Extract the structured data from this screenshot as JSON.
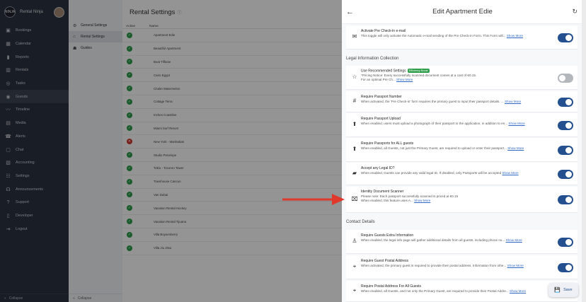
{
  "brand": {
    "name": "Rental Ninja",
    "logo_text": "NINJA"
  },
  "leftnav": {
    "items": [
      {
        "label": "Bookings",
        "icon": "book-icon",
        "glyph": "▣"
      },
      {
        "label": "Calendar",
        "icon": "calendar-icon",
        "glyph": "▦"
      },
      {
        "label": "Reports",
        "icon": "bar-chart-icon",
        "glyph": "▮"
      },
      {
        "label": "Rentals",
        "icon": "rentals-icon",
        "glyph": "▥"
      },
      {
        "label": "Tasks",
        "icon": "check-circle-icon",
        "glyph": "◎"
      },
      {
        "label": "Guests",
        "icon": "guests-icon",
        "glyph": "◉"
      },
      {
        "label": "Timeline",
        "icon": "timeline-icon",
        "glyph": "〰"
      },
      {
        "label": "Media",
        "icon": "media-icon",
        "glyph": "▤"
      },
      {
        "label": "Alerts",
        "icon": "alert-icon",
        "glyph": "☎"
      },
      {
        "label": "Chat",
        "icon": "chat-icon",
        "glyph": "▢"
      },
      {
        "label": "Accounting",
        "icon": "accounting-icon",
        "glyph": "▧"
      },
      {
        "label": "Settings",
        "icon": "settings-icon",
        "glyph": "☷"
      },
      {
        "label": "Announcements",
        "icon": "announcements-icon",
        "glyph": "☊"
      },
      {
        "label": "Support",
        "icon": "support-icon",
        "glyph": "?"
      },
      {
        "label": "Developer",
        "icon": "developer-icon",
        "glyph": "▯"
      },
      {
        "label": "Logout",
        "icon": "logout-icon",
        "glyph": "⇥"
      }
    ],
    "collapse_label": "Collapse"
  },
  "sidenav2": {
    "items": [
      {
        "label": "General Settings",
        "icon": "gear-icon",
        "glyph": "⚙"
      },
      {
        "label": "Rental Settings",
        "icon": "home-icon",
        "glyph": "⌂"
      },
      {
        "label": "Guides",
        "icon": "guides-icon",
        "glyph": "☗"
      }
    ],
    "collapse_label": "Collapse"
  },
  "main": {
    "title": "Rental Settings",
    "columns": {
      "active": "Active",
      "name": "Name"
    },
    "rows": [
      {
        "name": "Apartment Edie",
        "status": "active"
      },
      {
        "name": "Beautiful Apartment",
        "status": "active"
      },
      {
        "name": "Boat Tiffanie",
        "status": "active"
      },
      {
        "name": "Cairo Egypt",
        "status": "active"
      },
      {
        "name": "Chalet Watermelon",
        "status": "active"
      },
      {
        "name": "Cottage Terra",
        "status": "active"
      },
      {
        "name": "Inches Coastline",
        "status": "active"
      },
      {
        "name": "Miami Surf Resort",
        "status": "active"
      },
      {
        "name": "New York - Manhattan",
        "status": "inactive"
      },
      {
        "name": "Studio Penelope",
        "status": "active"
      },
      {
        "name": "Tokio - Toconru Tower",
        "status": "active"
      },
      {
        "name": "Townhouse Cancun",
        "status": "active"
      },
      {
        "name": "Van Dubai",
        "status": "active"
      },
      {
        "name": "Vacation Rental Hockey",
        "status": "active"
      },
      {
        "name": "Vacation Rental Tijuana",
        "status": "active"
      },
      {
        "name": "Villa Boysenberry",
        "status": "active"
      },
      {
        "name": "Villa Jiu Jitsu",
        "status": "active"
      }
    ]
  },
  "panel": {
    "title": "Edit Apartment Edie",
    "show_more": "Show More",
    "sections": {
      "legal": "Legal Information Collection",
      "contact": "Contact Details"
    },
    "settings": [
      {
        "title": "Activate Pre Check-in e-mail",
        "desc": "This toggle will only activate the Automatic e-mail sending of the Pre Check-in Form. This Form will...",
        "on": true,
        "icon": "email-icon",
        "glyph": "✉"
      },
      {
        "title": "Use Recommended Settings",
        "badge": "Efficiency Boost",
        "desc": "*Pricing Notice: Every successfully scanned document comes at a cost of €0.15.",
        "desc2": "For an optimal Pre Ch...",
        "on": false,
        "icon": "star-icon",
        "glyph": "☆"
      },
      {
        "title": "Require Passport Number",
        "desc": "When activated, the 'Pre Check-in' form requires the primary guest to input their passport details. ...",
        "on": true,
        "icon": "hash-icon",
        "glyph": "#"
      },
      {
        "title": "Require Passport Upload",
        "desc": "When enabled, users must upload a photograph of their passport to the application, in addition to en...",
        "on": true,
        "icon": "upload-icon",
        "glyph": "⬆"
      },
      {
        "title": "Require Passports for ALL guests",
        "desc": "When enabled, all Guests, not just the Primary Guest, are required to upload or enter their passport...",
        "on": true,
        "icon": "upload-icon",
        "glyph": "⬆"
      },
      {
        "title": "Accept any Legal ID?",
        "desc": "When enabled, Guests can provide any valid legal ID. If disabled, only Passports will be accepted",
        "on": true,
        "icon": "id-card-icon",
        "glyph": "▰"
      },
      {
        "title": "Identity Document Scanner",
        "desc": "Please note: Each passport successfully scanned is priced at €0.15",
        "desc2": "When enabled, this feature uses A...",
        "on": true,
        "icon": "scanner-icon",
        "glyph": "⌧"
      },
      {
        "title": "Require Guests Extra Information",
        "desc": "When enabled, the legal info page will gather additional details from all guests, including phone nu...",
        "on": true,
        "icon": "person-icon",
        "glyph": "♙"
      },
      {
        "title": "Require Guest Postal Address",
        "desc": "When activated, the primary guest is required to provide their postal address. Information from othe...",
        "on": true,
        "icon": "location-pin-icon",
        "glyph": "⌖"
      },
      {
        "title": "Require Postal Address For All Guests",
        "desc": "When enabled, all Guests, and not only the Primary Guest, are required to provide their Postal Addre...",
        "on": true,
        "icon": "location-pin-icon",
        "glyph": "⌖"
      }
    ],
    "save_label": "Save"
  },
  "colors": {
    "accent": "#24508f",
    "nav_bg": "#2b3240",
    "annotation": "#e0392b",
    "active_green": "#2e9e4a",
    "inactive_red": "#d03a2f"
  }
}
